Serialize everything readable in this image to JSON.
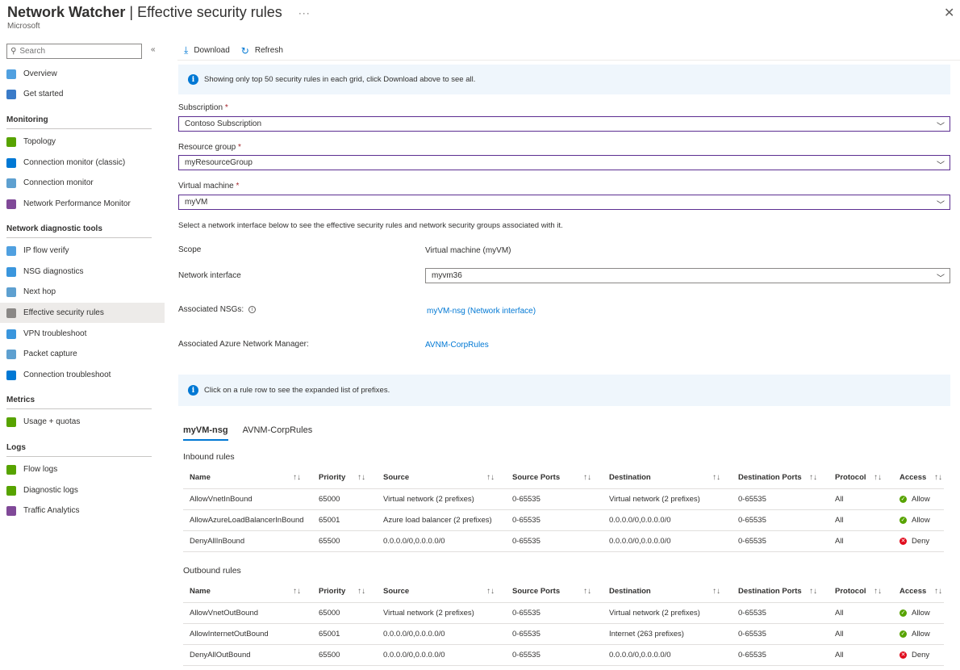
{
  "header": {
    "title_main": "Network Watcher",
    "title_sep": " | ",
    "title_sub": "Effective security rules",
    "more": "···",
    "publisher": "Microsoft",
    "close": "✕"
  },
  "sidebar": {
    "search_placeholder": "Search",
    "collapse": "«",
    "items_top": [
      {
        "label": "Overview",
        "icon": "globe-icon",
        "color": "#50a0e0"
      },
      {
        "label": "Get started",
        "icon": "cloud-icon",
        "color": "#3a7bc8"
      }
    ],
    "sections": [
      {
        "title": "Monitoring",
        "items": [
          {
            "label": "Topology",
            "icon": "topology-icon",
            "color": "#57a300"
          },
          {
            "label": "Connection monitor (classic)",
            "icon": "connection-monitor-classic-icon",
            "color": "#0078d4"
          },
          {
            "label": "Connection monitor",
            "icon": "connection-monitor-icon",
            "color": "#5ea0d0"
          },
          {
            "label": "Network Performance Monitor",
            "icon": "diamond-icon",
            "color": "#804998"
          }
        ]
      },
      {
        "title": "Network diagnostic tools",
        "items": [
          {
            "label": "IP flow verify",
            "icon": "ip-flow-icon",
            "color": "#50a0e0"
          },
          {
            "label": "NSG diagnostics",
            "icon": "nsg-diagnostics-icon",
            "color": "#3a96dd"
          },
          {
            "label": "Next hop",
            "icon": "next-hop-icon",
            "color": "#5ea0d0"
          },
          {
            "label": "Effective security rules",
            "icon": "effective-rules-icon",
            "color": "#8a8886",
            "active": true
          },
          {
            "label": "VPN troubleshoot",
            "icon": "vpn-icon",
            "color": "#3a96dd"
          },
          {
            "label": "Packet capture",
            "icon": "packet-capture-icon",
            "color": "#5ea0d0"
          },
          {
            "label": "Connection troubleshoot",
            "icon": "monitor-icon",
            "color": "#0078d4"
          }
        ]
      },
      {
        "title": "Metrics",
        "items": [
          {
            "label": "Usage + quotas",
            "icon": "usage-icon",
            "color": "#57a300"
          }
        ]
      },
      {
        "title": "Logs",
        "items": [
          {
            "label": "Flow logs",
            "icon": "flow-logs-icon",
            "color": "#57a300"
          },
          {
            "label": "Diagnostic logs",
            "icon": "diagnostic-logs-icon",
            "color": "#57a300"
          },
          {
            "label": "Traffic Analytics",
            "icon": "traffic-analytics-icon",
            "color": "#804998"
          }
        ]
      }
    ]
  },
  "toolbar": {
    "download": "Download",
    "refresh": "Refresh"
  },
  "banner1": "Showing only top 50 security rules in each grid, click Download above to see all.",
  "form": {
    "subscription_label": "Subscription",
    "subscription_value": "Contoso Subscription",
    "rg_label": "Resource group",
    "rg_value": "myResourceGroup",
    "vm_label": "Virtual machine",
    "vm_value": "myVM",
    "required": "*"
  },
  "hint": "Select a network interface below to see the effective security rules and network security groups associated with it.",
  "details": {
    "scope_label": "Scope",
    "scope_value": "Virtual machine (myVM)",
    "nic_label": "Network interface",
    "nic_value": "myvm36",
    "nsgs_label": "Associated NSGs:",
    "nsgs_value": "myVM-nsg (Network interface)",
    "avnm_label": "Associated Azure Network Manager:",
    "avnm_value": "AVNM-CorpRules"
  },
  "banner2": "Click on a rule row to see the expanded list of prefixes.",
  "tabs": [
    "myVM-nsg",
    "AVNM-CorpRules"
  ],
  "columns": [
    "Name",
    "Priority",
    "Source",
    "Source Ports",
    "Destination",
    "Destination Ports",
    "Protocol",
    "Access"
  ],
  "sort_glyph": "↑↓",
  "inbound": {
    "title": "Inbound rules",
    "rows": [
      [
        "AllowVnetInBound",
        "65000",
        "Virtual network (2 prefixes)",
        "0-65535",
        "Virtual network (2 prefixes)",
        "0-65535",
        "All",
        "Allow"
      ],
      [
        "AllowAzureLoadBalancerInBound",
        "65001",
        "Azure load balancer (2 prefixes)",
        "0-65535",
        "0.0.0.0/0,0.0.0.0/0",
        "0-65535",
        "All",
        "Allow"
      ],
      [
        "DenyAllInBound",
        "65500",
        "0.0.0.0/0,0.0.0.0/0",
        "0-65535",
        "0.0.0.0/0,0.0.0.0/0",
        "0-65535",
        "All",
        "Deny"
      ]
    ]
  },
  "outbound": {
    "title": "Outbound rules",
    "rows": [
      [
        "AllowVnetOutBound",
        "65000",
        "Virtual network (2 prefixes)",
        "0-65535",
        "Virtual network (2 prefixes)",
        "0-65535",
        "All",
        "Allow"
      ],
      [
        "AllowInternetOutBound",
        "65001",
        "0.0.0.0/0,0.0.0.0/0",
        "0-65535",
        "Internet (263 prefixes)",
        "0-65535",
        "All",
        "Allow"
      ],
      [
        "DenyAllOutBound",
        "65500",
        "0.0.0.0/0,0.0.0.0/0",
        "0-65535",
        "0.0.0.0/0,0.0.0.0/0",
        "0-65535",
        "All",
        "Deny"
      ]
    ]
  }
}
